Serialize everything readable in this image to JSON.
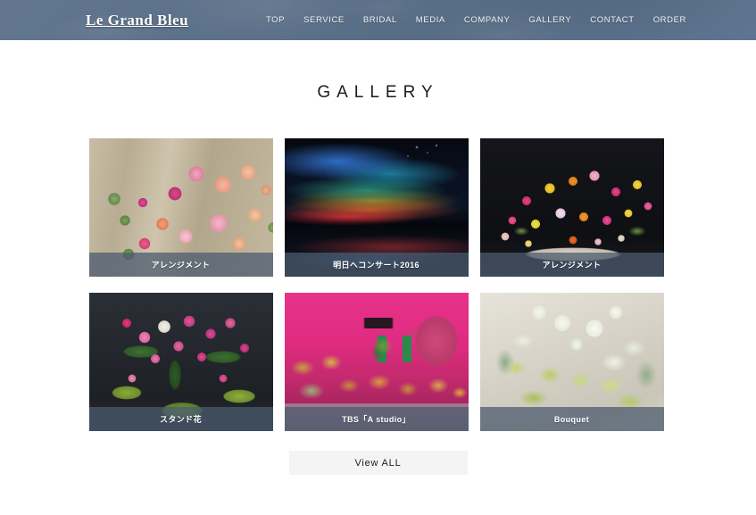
{
  "header": {
    "logo": "Le Grand Bleu",
    "background_color": "#5b7089",
    "nav": [
      {
        "label": "TOP"
      },
      {
        "label": "SERVICE"
      },
      {
        "label": "BRIDAL"
      },
      {
        "label": "MEDIA"
      },
      {
        "label": "COMPANY"
      },
      {
        "label": "GALLERY"
      },
      {
        "label": "CONTACT"
      },
      {
        "label": "ORDER"
      }
    ]
  },
  "main": {
    "page_title": "GALLERY",
    "gallery": [
      {
        "caption": "アレンジメント",
        "photo": "pink-peach-flower-arrangement-on-wood",
        "art_class": "photo-arrangement-pink"
      },
      {
        "caption": "明日へコンサート2016",
        "photo": "concert-stage-rainbow-lights-night",
        "art_class": "photo-concert"
      },
      {
        "caption": "アレンジメント",
        "photo": "colorful-gerbera-arrangement-white-bowl",
        "art_class": "photo-arrangement-gerbera"
      },
      {
        "caption": "スタンド花",
        "photo": "pink-stand-flower-arrangement",
        "art_class": "photo-stand-flower"
      },
      {
        "caption": "TBS「A studio」",
        "photo": "tbs-studio-pink-set-with-elephant",
        "art_class": "photo-tbs-studio"
      },
      {
        "caption": "Bouquet",
        "photo": "white-green-hellebore-bouquet",
        "art_class": "photo-bouquet"
      }
    ],
    "view_all_label": "View ALL"
  }
}
